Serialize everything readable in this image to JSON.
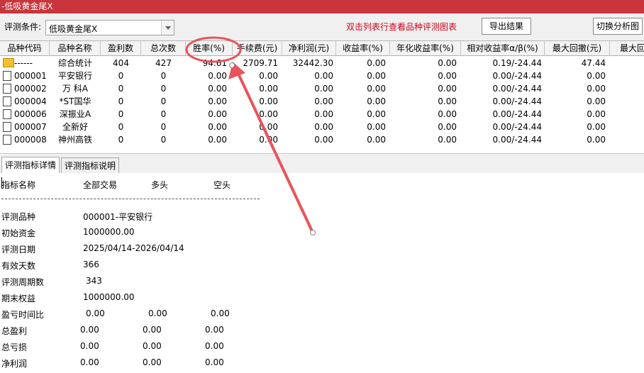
{
  "window": {
    "title": "-低吸黄金尾X"
  },
  "toolbar": {
    "label": "评测条件:",
    "combo_value": "低吸黄金尾X",
    "hint": "双击列表行查看品种评测图表",
    "export_label": "导出结果",
    "switch_label": "切换分析图"
  },
  "grid": {
    "headers": [
      "品种代码",
      "品种名称",
      "盈利数",
      "总次数",
      "胜率(%)",
      "手续费(元)",
      "净利润(元)",
      "收益率(%)",
      "年化收益率(%)",
      "相对收益率α/β(%)",
      "最大回撤(元)",
      "最大回"
    ],
    "rows": [
      {
        "code": "------",
        "name": "综合统计",
        "win": "404",
        "total": "427",
        "rate": "94.61",
        "fee": "2709.71",
        "profit": "32442.30",
        "ret": "0.00",
        "annual": "0.00",
        "rel": "0.19/-24.44",
        "dd": "47.44"
      },
      {
        "code": "000001",
        "name": "平安银行",
        "win": "0",
        "total": "0",
        "rate": "0.00",
        "fee": "0.00",
        "profit": "0.00",
        "ret": "0.00",
        "annual": "0.00",
        "rel": "0.00/-24.44",
        "dd": "0.00"
      },
      {
        "code": "000002",
        "name": "万 科A",
        "win": "0",
        "total": "0",
        "rate": "0.00",
        "fee": "0.00",
        "profit": "0.00",
        "ret": "0.00",
        "annual": "0.00",
        "rel": "0.00/-24.44",
        "dd": "0.00"
      },
      {
        "code": "000004",
        "name": "*ST国华",
        "win": "0",
        "total": "0",
        "rate": "0.00",
        "fee": "0.00",
        "profit": "0.00",
        "ret": "0.00",
        "annual": "0.00",
        "rel": "0.00/-24.44",
        "dd": "0.00"
      },
      {
        "code": "000006",
        "name": "深振业A",
        "win": "0",
        "total": "0",
        "rate": "0.00",
        "fee": "0.00",
        "profit": "0.00",
        "ret": "0.00",
        "annual": "0.00",
        "rel": "0.00/-24.44",
        "dd": "0.00"
      },
      {
        "code": "000007",
        "name": "全新好",
        "win": "0",
        "total": "0",
        "rate": "0.00",
        "fee": "0.00",
        "profit": "0.00",
        "ret": "0.00",
        "annual": "0.00",
        "rel": "0.00/-24.44",
        "dd": "0.00"
      },
      {
        "code": "000008",
        "name": "神州高铁",
        "win": "0",
        "total": "0",
        "rate": "0.00",
        "fee": "0.00",
        "profit": "0.00",
        "ret": "0.00",
        "annual": "0.00",
        "rel": "0.00/-24.44",
        "dd": "0.00"
      }
    ]
  },
  "tabs": [
    "评测指标详情",
    "评测指标说明"
  ],
  "detail": {
    "col_headers": [
      "指标名称",
      "全部交易",
      "多头",
      "空头"
    ],
    "rows": [
      {
        "label": "评测品种",
        "v1": "000001-平安银行"
      },
      {
        "label": "初始资金",
        "v1": "1000000.00"
      },
      {
        "label": "评测日期",
        "v1": "2025/04/14-2026/04/14"
      },
      {
        "label": "有效天数",
        "v1": "366"
      },
      {
        "label": "评测周期数",
        "v1": "343"
      },
      {
        "label": "期末权益",
        "v1": "1000000.00"
      },
      {
        "label": "盈亏时间比",
        "v1": "0.00",
        "v2": "0.00",
        "v3": "0.00"
      },
      {
        "label": "总盈利",
        "v1": "0.00",
        "v2": "0.00",
        "v3": "0.00"
      },
      {
        "label": "总亏损",
        "v1": "0.00",
        "v2": "0.00",
        "v3": "0.00"
      },
      {
        "label": "净利润",
        "v1": "0.00",
        "v2": "0.00",
        "v3": "0.00"
      }
    ]
  },
  "colors": {
    "titlebar": "#c8353c",
    "hint": "#d0021b",
    "annotation": "#e8545c"
  }
}
